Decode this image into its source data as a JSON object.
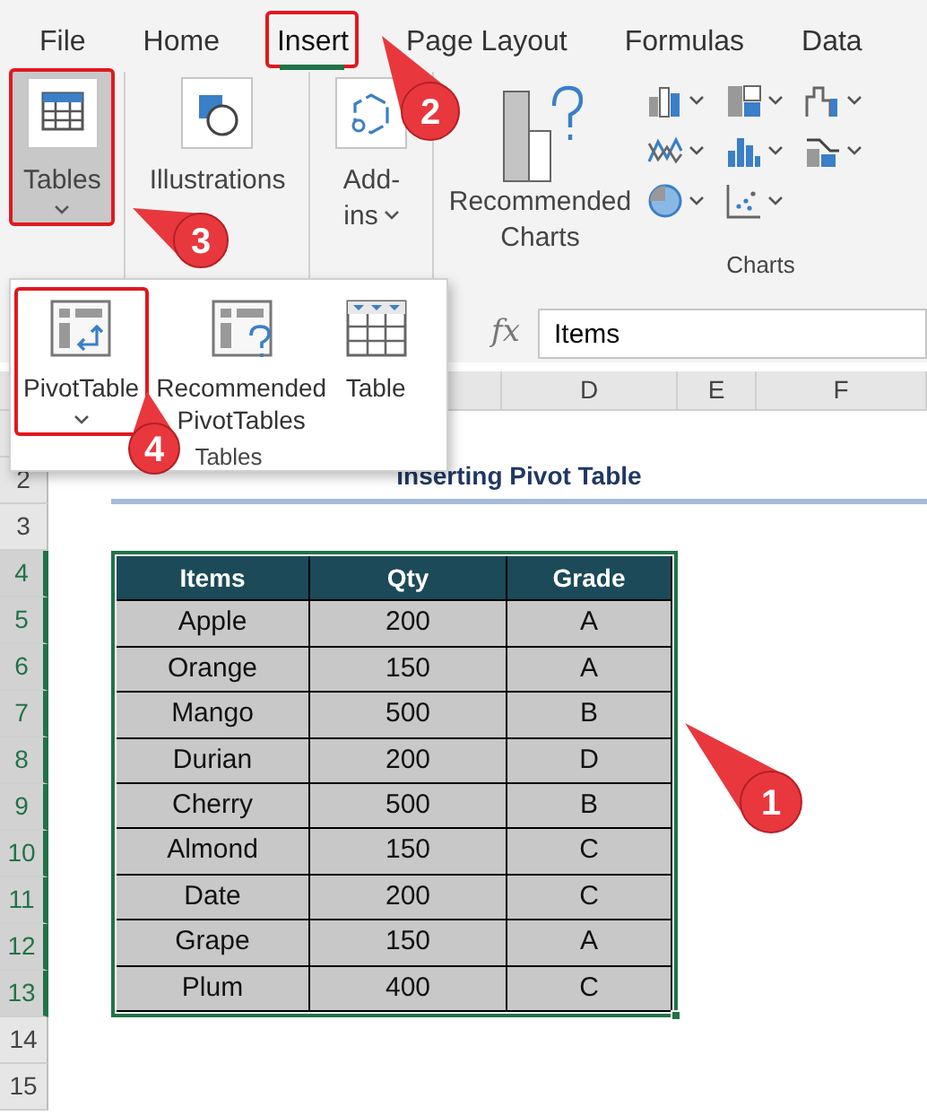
{
  "ribbon_tabs": [
    {
      "label": "File",
      "selected": false,
      "highlighted": false
    },
    {
      "label": "Home",
      "selected": false,
      "highlighted": false
    },
    {
      "label": "Insert",
      "selected": true,
      "highlighted": true
    },
    {
      "label": "Page Layout",
      "selected": false,
      "highlighted": false
    },
    {
      "label": "Formulas",
      "selected": false,
      "highlighted": false
    },
    {
      "label": "Data",
      "selected": false,
      "highlighted": false
    }
  ],
  "ribbon_buttons": [
    {
      "label": "Tables",
      "kind": "tables",
      "selected": true,
      "highlighted": true,
      "dropdown": true
    },
    {
      "label": "Illustrations",
      "kind": "illustrations",
      "selected": false,
      "highlighted": false,
      "dropdown": false
    },
    {
      "label": "Add-ins",
      "kind": "addins",
      "selected": false,
      "highlighted": false,
      "dropdown": true
    },
    {
      "label": "Recommended Charts",
      "kind": "charts",
      "selected": false,
      "highlighted": false,
      "dropdown": false
    }
  ],
  "charts_group_label": "Charts",
  "tables_dropdown": {
    "items": [
      {
        "label": "PivotTable",
        "kind": "pivot",
        "highlighted": true,
        "dropdown": true
      },
      {
        "label": "Recommended PivotTables",
        "kind": "recpivot",
        "highlighted": false,
        "dropdown": false
      },
      {
        "label": "Table",
        "kind": "table",
        "highlighted": false,
        "dropdown": false
      }
    ],
    "group_label": "Tables"
  },
  "formula_bar": {
    "fx": "fx",
    "value": "Items"
  },
  "columns": [
    {
      "label": "D"
    },
    {
      "label": "E"
    },
    {
      "label": "F"
    }
  ],
  "rows": [
    {
      "label": "2",
      "selected": false
    },
    {
      "label": "3",
      "selected": false
    },
    {
      "label": "4",
      "selected": true
    },
    {
      "label": "5",
      "selected": true
    },
    {
      "label": "6",
      "selected": true
    },
    {
      "label": "7",
      "selected": true
    },
    {
      "label": "8",
      "selected": true
    },
    {
      "label": "9",
      "selected": true
    },
    {
      "label": "10",
      "selected": true
    },
    {
      "label": "11",
      "selected": true
    },
    {
      "label": "12",
      "selected": true
    },
    {
      "label": "13",
      "selected": true
    },
    {
      "label": "14",
      "selected": false
    },
    {
      "label": "15",
      "selected": false
    }
  ],
  "title": "Inserting Pivot Table",
  "table": {
    "columns": [
      "Items",
      "Qty",
      "Grade"
    ],
    "rows": [
      [
        "Apple",
        "200",
        "A"
      ],
      [
        "Orange",
        "150",
        "A"
      ],
      [
        "Mango",
        "500",
        "B"
      ],
      [
        "Durian",
        "200",
        "D"
      ],
      [
        "Cherry",
        "500",
        "B"
      ],
      [
        "Almond",
        "150",
        "C"
      ],
      [
        "Date",
        "200",
        "C"
      ],
      [
        "Grape",
        "150",
        "A"
      ],
      [
        "Plum",
        "400",
        "C"
      ]
    ]
  },
  "callouts": [
    {
      "number": "2"
    },
    {
      "number": "3"
    },
    {
      "number": "4"
    },
    {
      "number": "1"
    }
  ]
}
